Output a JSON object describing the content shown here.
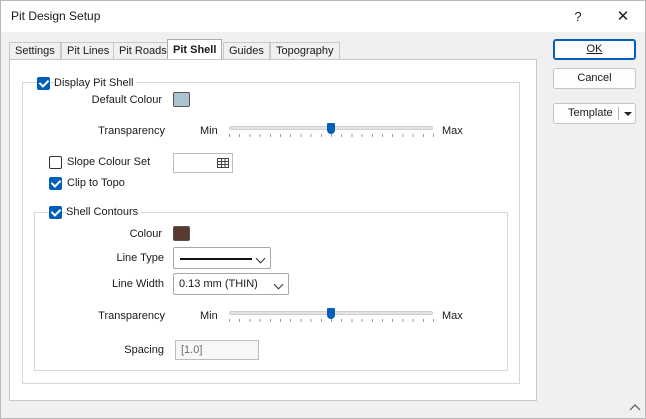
{
  "window": {
    "title": "Pit Design Setup",
    "help_glyph": "?",
    "close_glyph": "✕"
  },
  "tabs": [
    {
      "label": "Settings",
      "active": false
    },
    {
      "label": "Pit Lines",
      "active": false
    },
    {
      "label": "Pit Roads",
      "active": false
    },
    {
      "label": "Pit Shell",
      "active": true
    },
    {
      "label": "Guides",
      "active": false
    },
    {
      "label": "Topography",
      "active": false
    }
  ],
  "display_pit_shell": {
    "label": "Display Pit Shell",
    "checked": true,
    "default_colour_label": "Default Colour",
    "default_colour": "#a9c3d1",
    "transparency_label": "Transparency",
    "min_label": "Min",
    "max_label": "Max",
    "transparency_value": 0.5
  },
  "slope_colour_set": {
    "label": "Slope Colour Set",
    "checked": false,
    "value": ""
  },
  "clip_to_topo": {
    "label": "Clip to Topo",
    "checked": true
  },
  "shell_contours": {
    "label": "Shell Contours",
    "checked": true,
    "colour_label": "Colour",
    "colour": "#5a3a2e",
    "line_type_label": "Line Type",
    "line_width_label": "Line Width",
    "line_width_value": "0.13 mm (THIN)",
    "transparency_label": "Transparency",
    "min_label": "Min",
    "max_label": "Max",
    "transparency_value": 0.5,
    "spacing_label": "Spacing",
    "spacing_value": "[1.0]"
  },
  "buttons": {
    "ok": "OK",
    "cancel": "Cancel",
    "template": "Template"
  },
  "colors": {
    "accent": "#005fb8"
  }
}
